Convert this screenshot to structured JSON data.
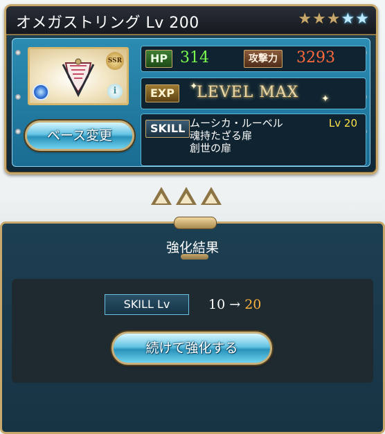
{
  "weapon": {
    "name": "オメガストリング",
    "level_text": "Lv 200",
    "rarity": "SSR",
    "uncap_stars": [
      "gold",
      "gold",
      "gold",
      "blue",
      "blue"
    ],
    "info_glyph": "i"
  },
  "stats": {
    "hp_label": "HP",
    "hp_value": "314",
    "atk_label": "攻撃力",
    "atk_value": "3293",
    "exp_label": "EXP",
    "exp_value": "LEVEL MAX"
  },
  "skill": {
    "label": "SKILL",
    "name": "ムーシカ・ルーベル",
    "level": "Lv 20",
    "line2": "魂持たざる扉",
    "line3": "創世の扉"
  },
  "buttons": {
    "base_change": "ベース変更",
    "continue": "続けて強化する"
  },
  "result": {
    "title": "強化結果",
    "skill_lv_label": "SKILL Lv",
    "from": "10",
    "arrow": "→",
    "to": "20"
  },
  "colors": {
    "hp": "#7bff4e",
    "atk": "#ff6a3d",
    "skill_lv": "#ffe14a",
    "new_level": "#ffb340",
    "frame_gold": "#c9a86b"
  }
}
